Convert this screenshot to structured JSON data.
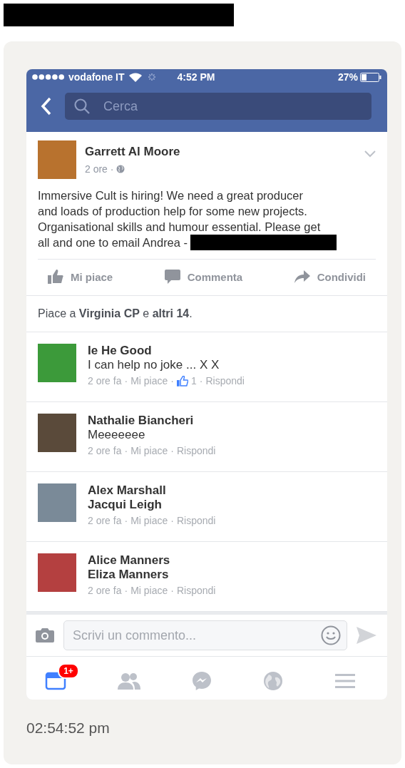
{
  "status_bar": {
    "carrier": "vodafone IT",
    "time": "4:52 PM",
    "battery": "27%"
  },
  "nav": {
    "search": {
      "placeholder": "Cerca"
    }
  },
  "post": {
    "author": "Garrett Al Moore",
    "time": "2 ore ·",
    "text_lines": [
      "Immersive Cult is hiring! We need a great producer",
      "and loads of production help for some new projects.",
      "Organisational skills and humour essential. Please get",
      "all and one to email Andrea -"
    ],
    "actions": [
      {
        "kind": "like",
        "label": "Mi piace"
      },
      {
        "kind": "comment",
        "label": "Commenta"
      },
      {
        "kind": "share",
        "label": "Condividi"
      }
    ],
    "likes": "Piace a **Virginia CP** e **altri 14**."
  },
  "comments": [
    {
      "author": "Ie He Good",
      "text": "I can help no joke ... X X",
      "meta": [
        {
          "kind": "time",
          "text": "2 ore fa"
        },
        {
          "kind": "sep",
          "text": "·"
        },
        {
          "kind": "link",
          "text": "Mi piace"
        },
        {
          "kind": "sep",
          "text": "·"
        },
        {
          "kind": "likes",
          "text": "1"
        },
        {
          "kind": "sep",
          "text": "·"
        },
        {
          "kind": "link",
          "text": "Rispondi"
        }
      ]
    },
    {
      "author": "Nathalie Biancheri",
      "text": "Meeeeeee",
      "meta": [
        {
          "kind": "time",
          "text": "2 ore fa"
        },
        {
          "kind": "sep",
          "text": "·"
        },
        {
          "kind": "link",
          "text": "Mi piace"
        },
        {
          "kind": "sep",
          "text": "·"
        },
        {
          "kind": "link",
          "text": "Rispondi"
        }
      ]
    },
    {
      "author": "Alex Marshall",
      "mention": "Jacqui Leigh",
      "meta": [
        {
          "kind": "time",
          "text": "2 ore fa"
        },
        {
          "kind": "sep",
          "text": "·"
        },
        {
          "kind": "link",
          "text": "Mi piace"
        },
        {
          "kind": "sep",
          "text": "·"
        },
        {
          "kind": "link",
          "text": "Rispondi"
        }
      ]
    },
    {
      "author": "Alice Manners",
      "mention": "Eliza Manners",
      "meta": [
        {
          "kind": "time",
          "text": "2 ore fa"
        },
        {
          "kind": "sep",
          "text": "·"
        },
        {
          "kind": "link",
          "text": "Mi piace"
        },
        {
          "kind": "sep",
          "text": "·"
        },
        {
          "kind": "link",
          "text": "Rispondi"
        }
      ]
    }
  ],
  "composer": {
    "placeholder": "Scrivi un commento..."
  },
  "tab_bar": [
    {
      "kind": "feed",
      "selected": true,
      "badge": "1+"
    },
    {
      "kind": "friends",
      "selected": false
    },
    {
      "kind": "messenger",
      "selected": false
    },
    {
      "kind": "globe",
      "selected": false
    },
    {
      "kind": "menu",
      "selected": false
    }
  ],
  "timestamp": "02:54:52 pm"
}
